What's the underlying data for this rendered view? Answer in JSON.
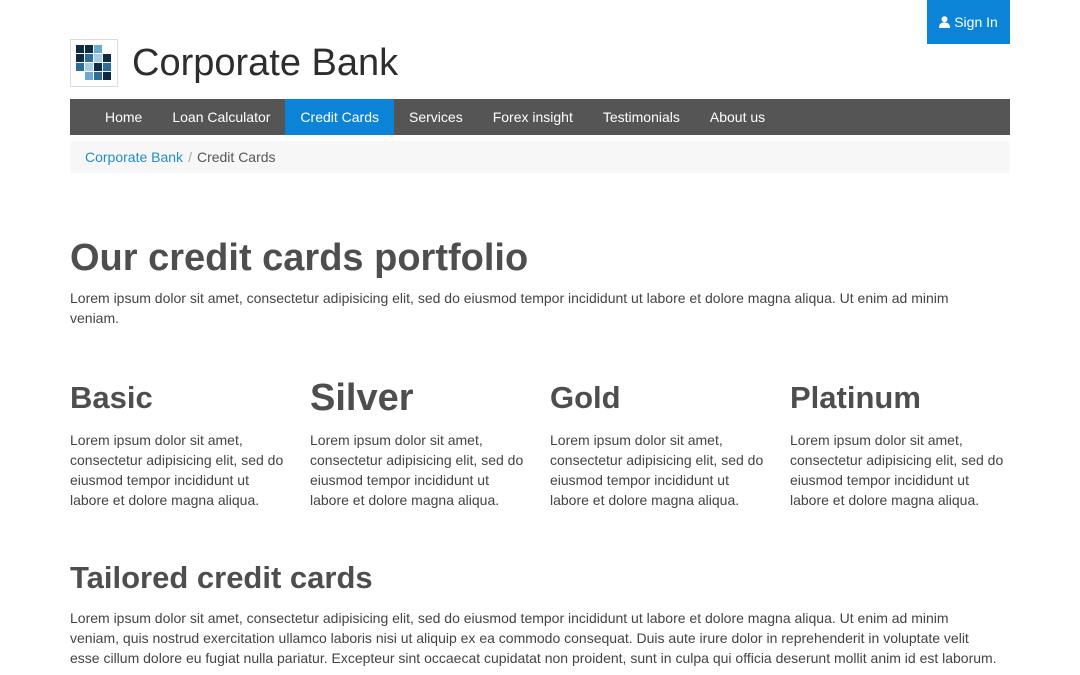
{
  "signin": {
    "label": "Sign In",
    "icon": "user-icon"
  },
  "header": {
    "brand": "Corporate Bank",
    "logo_icon": "bank-logo-icon"
  },
  "nav": {
    "items": [
      {
        "label": "Home"
      },
      {
        "label": "Loan Calculator"
      },
      {
        "label": "Credit Cards"
      },
      {
        "label": "Services"
      },
      {
        "label": "Forex insight"
      },
      {
        "label": "Testimonials"
      },
      {
        "label": "About us"
      }
    ],
    "active": "Credit Cards"
  },
  "breadcrumb": {
    "home": "Corporate Bank",
    "separator": "/",
    "current": "Credit Cards"
  },
  "main": {
    "title": "Our credit cards portfolio",
    "intro": "Lorem ipsum dolor sit amet, consectetur adipisicing elit, sed do eiusmod tempor incididunt ut labore et dolore magna aliqua. Ut enim ad minim veniam.",
    "cards": [
      {
        "title": "Basic",
        "text": "Lorem ipsum dolor sit amet, consectetur adipisicing elit, sed do eiusmod tempor incididunt ut labore et dolore magna aliqua."
      },
      {
        "title": "Silver",
        "text": "Lorem ipsum dolor sit amet, consectetur adipisicing elit, sed do eiusmod tempor incididunt ut labore et dolore magna aliqua."
      },
      {
        "title": "Gold",
        "text": "Lorem ipsum dolor sit amet, consectetur adipisicing elit, sed do eiusmod tempor incididunt ut labore et dolore magna aliqua."
      },
      {
        "title": "Platinum",
        "text": "Lorem ipsum dolor sit amet, consectetur adipisicing elit, sed do eiusmod tempor incididunt ut labore et dolore magna aliqua."
      }
    ],
    "tailored_title": "Tailored credit cards",
    "tailored_text": "Lorem ipsum dolor sit amet, consectetur adipisicing elit, sed do eiusmod tempor incididunt ut labore et dolore magna aliqua. Ut enim ad minim veniam, quis nostrud exercitation ullamco laboris nisi ut aliquip ex ea commodo consequat. Duis aute irure dolor in reprehenderit in voluptate velit esse cillum dolore eu fugiat nulla pariatur. Excepteur sint occaecat cupidatat non proident, sunt in culpa qui officia deserunt mollit anim id est laborum."
  },
  "colors": {
    "accent": "#0b84d8",
    "navbar": "#555555",
    "link": "#1f8fc9",
    "heading": "#4e4e4e"
  }
}
